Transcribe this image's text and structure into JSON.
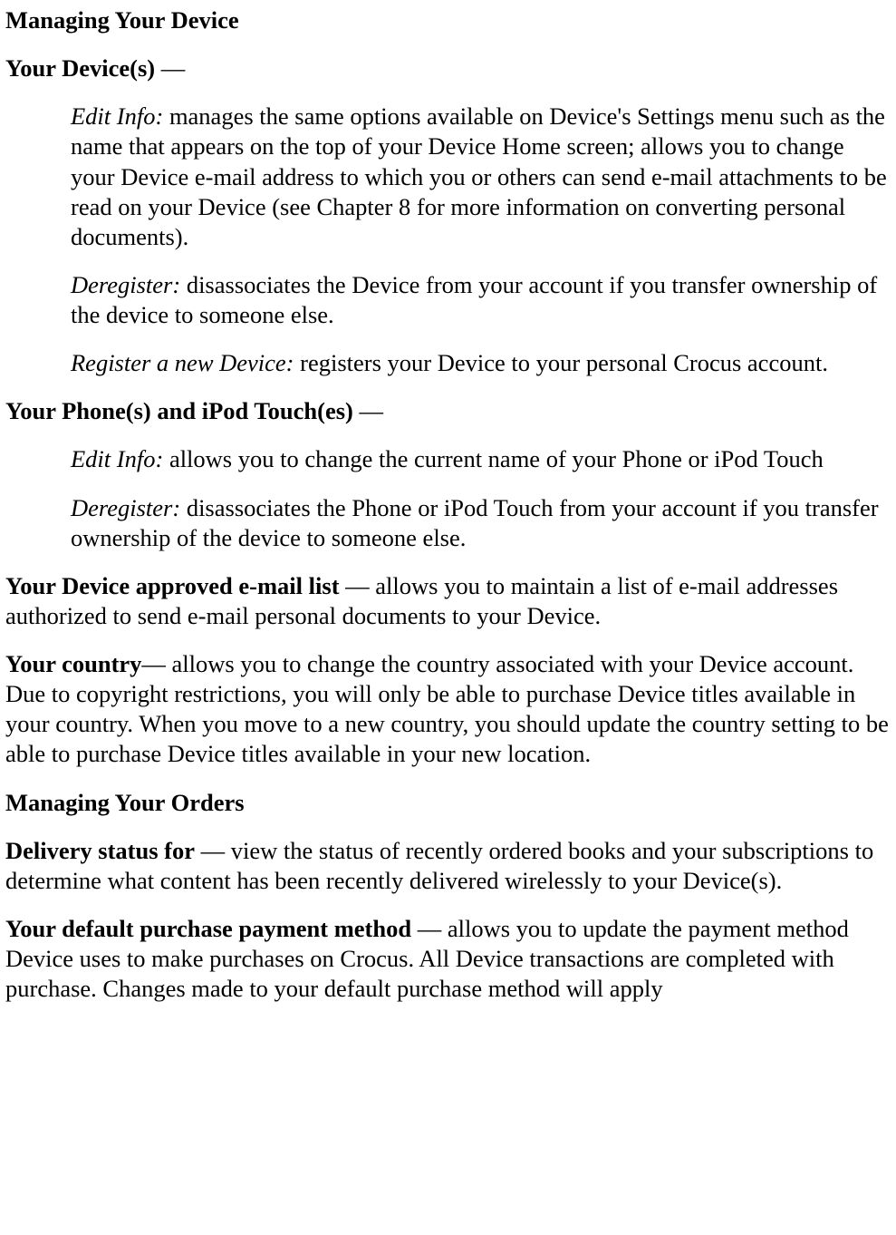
{
  "headings": {
    "managing_device": "Managing Your Device",
    "managing_orders": "Managing Your Orders"
  },
  "your_devices": {
    "label": "Your Device(s)",
    "dash": " —",
    "edit_info_label": "Edit Info:",
    "edit_info_text": " manages the same options available on Device's Settings menu such as the name that appears on the top of your Device Home screen; allows you to change your Device e-mail address to which you or others can send e-mail attachments to be read on your Device (see Chapter 8 for more information on converting personal documents).",
    "deregister_label": "Deregister:",
    "deregister_text": " disassociates the Device from your account if you transfer ownership of the device to someone else.",
    "register_label": "Register a new Device:",
    "register_text": " registers your Device to your personal Crocus account."
  },
  "your_phones": {
    "label": "Your Phone(s) and iPod Touch(es)",
    "dash": " —",
    "edit_info_label": "Edit Info:",
    "edit_info_text": " allows you to change the current name of your Phone or iPod Touch",
    "deregister_label": "Deregister:",
    "deregister_text": " disassociates the Phone or iPod Touch from your account if you transfer ownership of the device to someone else."
  },
  "email_list": {
    "label": "Your Device approved e-mail list",
    "text": " — allows you to maintain a list of e-mail addresses authorized to send e-mail personal documents to your Device."
  },
  "your_country": {
    "label": "Your country",
    "text": "— allows you to change the country associated with your Device account.  Due to copyright restrictions, you will only be able to purchase Device titles available in your country.  When you move to a new country, you should update the country setting to be able to purchase Device titles available in your new location."
  },
  "delivery_status": {
    "label": "Delivery status for",
    "text": " — view the status of recently ordered books and your subscriptions to determine what content has been recently delivered wirelessly to your Device(s)."
  },
  "payment_method": {
    "label": "Your default purchase payment method",
    "text": " — allows you to update the payment method Device uses to make purchases on Crocus. All Device transactions are completed with purchase. Changes made to your default purchase method will apply"
  }
}
